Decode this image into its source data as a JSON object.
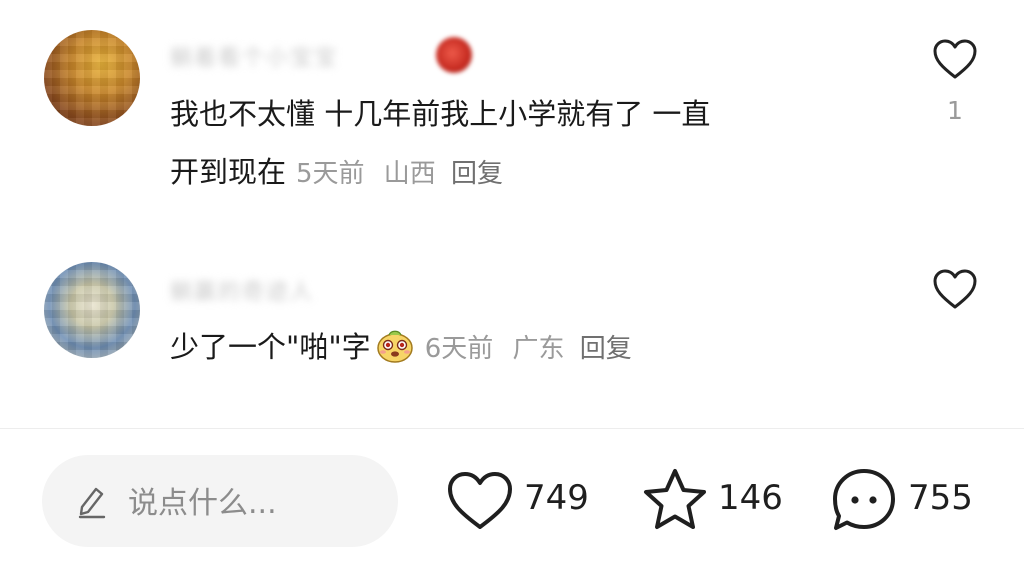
{
  "comments": [
    {
      "username": "躺着看个小宝宝",
      "text_line1": "我也不太懂 十几年前我上小学就有了 一直",
      "text_line2": "开到现在",
      "time": "5天前",
      "location": "山西",
      "reply_label": "回复",
      "like_count": "1",
      "avatar_icon": "avatar-orange",
      "badge_icon": "apple-badge-icon"
    },
    {
      "username": "躺赢的奇迹人",
      "text": "少了一个\"啪\"字",
      "emoji_icon": "cute-blush-face-icon",
      "time": "6天前",
      "location": "广东",
      "reply_label": "回复",
      "like_count": "",
      "avatar_icon": "avatar-blue"
    }
  ],
  "bottom_bar": {
    "input_placeholder": "说点什么...",
    "like_count": "749",
    "favorite_count": "146",
    "comment_count": "755"
  },
  "colors": {
    "meta": "#9a9a9a",
    "text": "#1a1a1a",
    "input_bg": "#f4f4f4"
  }
}
